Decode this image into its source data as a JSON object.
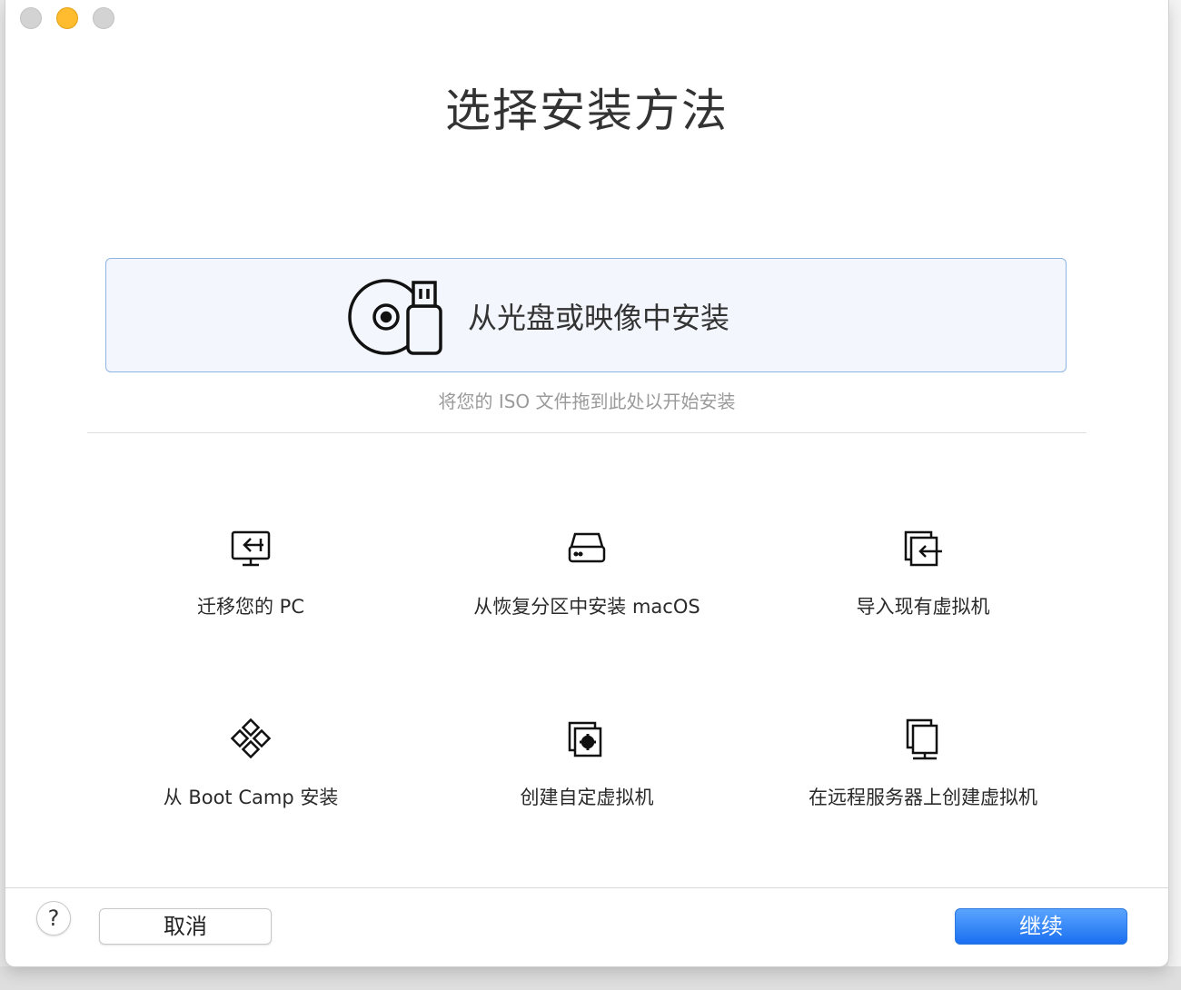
{
  "window": {
    "title": "选择安装方法",
    "traffic_lights": [
      "close",
      "minimize",
      "zoom"
    ]
  },
  "drop_zone": {
    "label": "从光盘或映像中安装",
    "hint": "将您的 ISO 文件拖到此处以开始安装",
    "icon": "disc-usb-icon"
  },
  "options": [
    {
      "label": "迁移您的 PC",
      "icon": "migrate-pc-icon"
    },
    {
      "label": "从恢复分区中安装 macOS",
      "icon": "hard-drive-icon"
    },
    {
      "label": "导入现有虚拟机",
      "icon": "import-vm-icon"
    },
    {
      "label": "从 Boot Camp 安装",
      "icon": "bootcamp-icon"
    },
    {
      "label": "创建自定虚拟机",
      "icon": "custom-vm-icon"
    },
    {
      "label": "在远程服务器上创建虚拟机",
      "icon": "remote-server-icon"
    }
  ],
  "footer": {
    "help_label": "?",
    "cancel_label": "取消",
    "continue_label": "继续"
  },
  "colors": {
    "accent": "#1a6ff0",
    "drop_zone_border": "#8fb4e4",
    "drop_zone_bg": "#f3f7fd",
    "minimize_light": "#febc2e"
  }
}
